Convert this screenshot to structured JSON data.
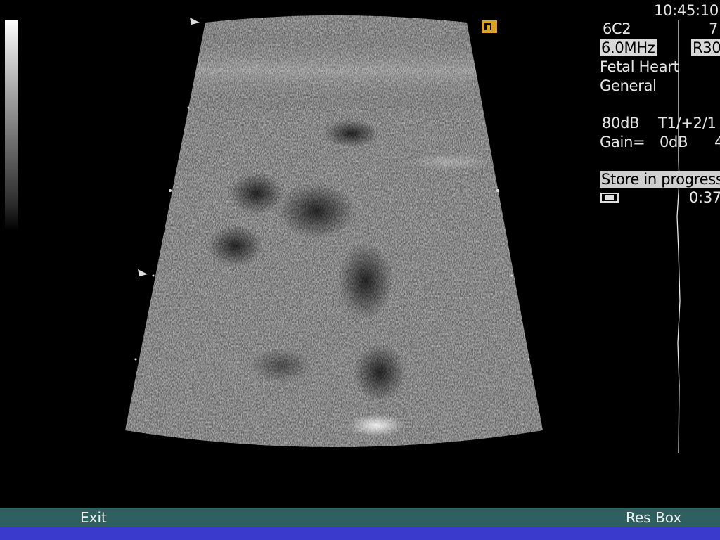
{
  "header": {
    "time": "10:45:10"
  },
  "probe": {
    "name": "6C2",
    "right_partial": "7",
    "frequency": "6.0MHz",
    "resolution": "R30"
  },
  "preset": {
    "application": "Fetal Heart",
    "mode": "General"
  },
  "settings": {
    "dynamic_range": "80dB",
    "tgc": "T1/+2/1",
    "gain_label": "Gain=",
    "gain_value": "0dB",
    "gain_extra": "4"
  },
  "store": {
    "status": "Store in progress",
    "elapsed": "0:37"
  },
  "softkeys": {
    "exit": "Exit",
    "res_box": "Res Box"
  },
  "colors": {
    "bottom_bar": "#2e6060",
    "blue_strip": "#3a3acc",
    "orientation_marker": "#e0a020"
  },
  "icons": {
    "orientation": "orientation-marker-icon",
    "tape": "tape-icon"
  }
}
